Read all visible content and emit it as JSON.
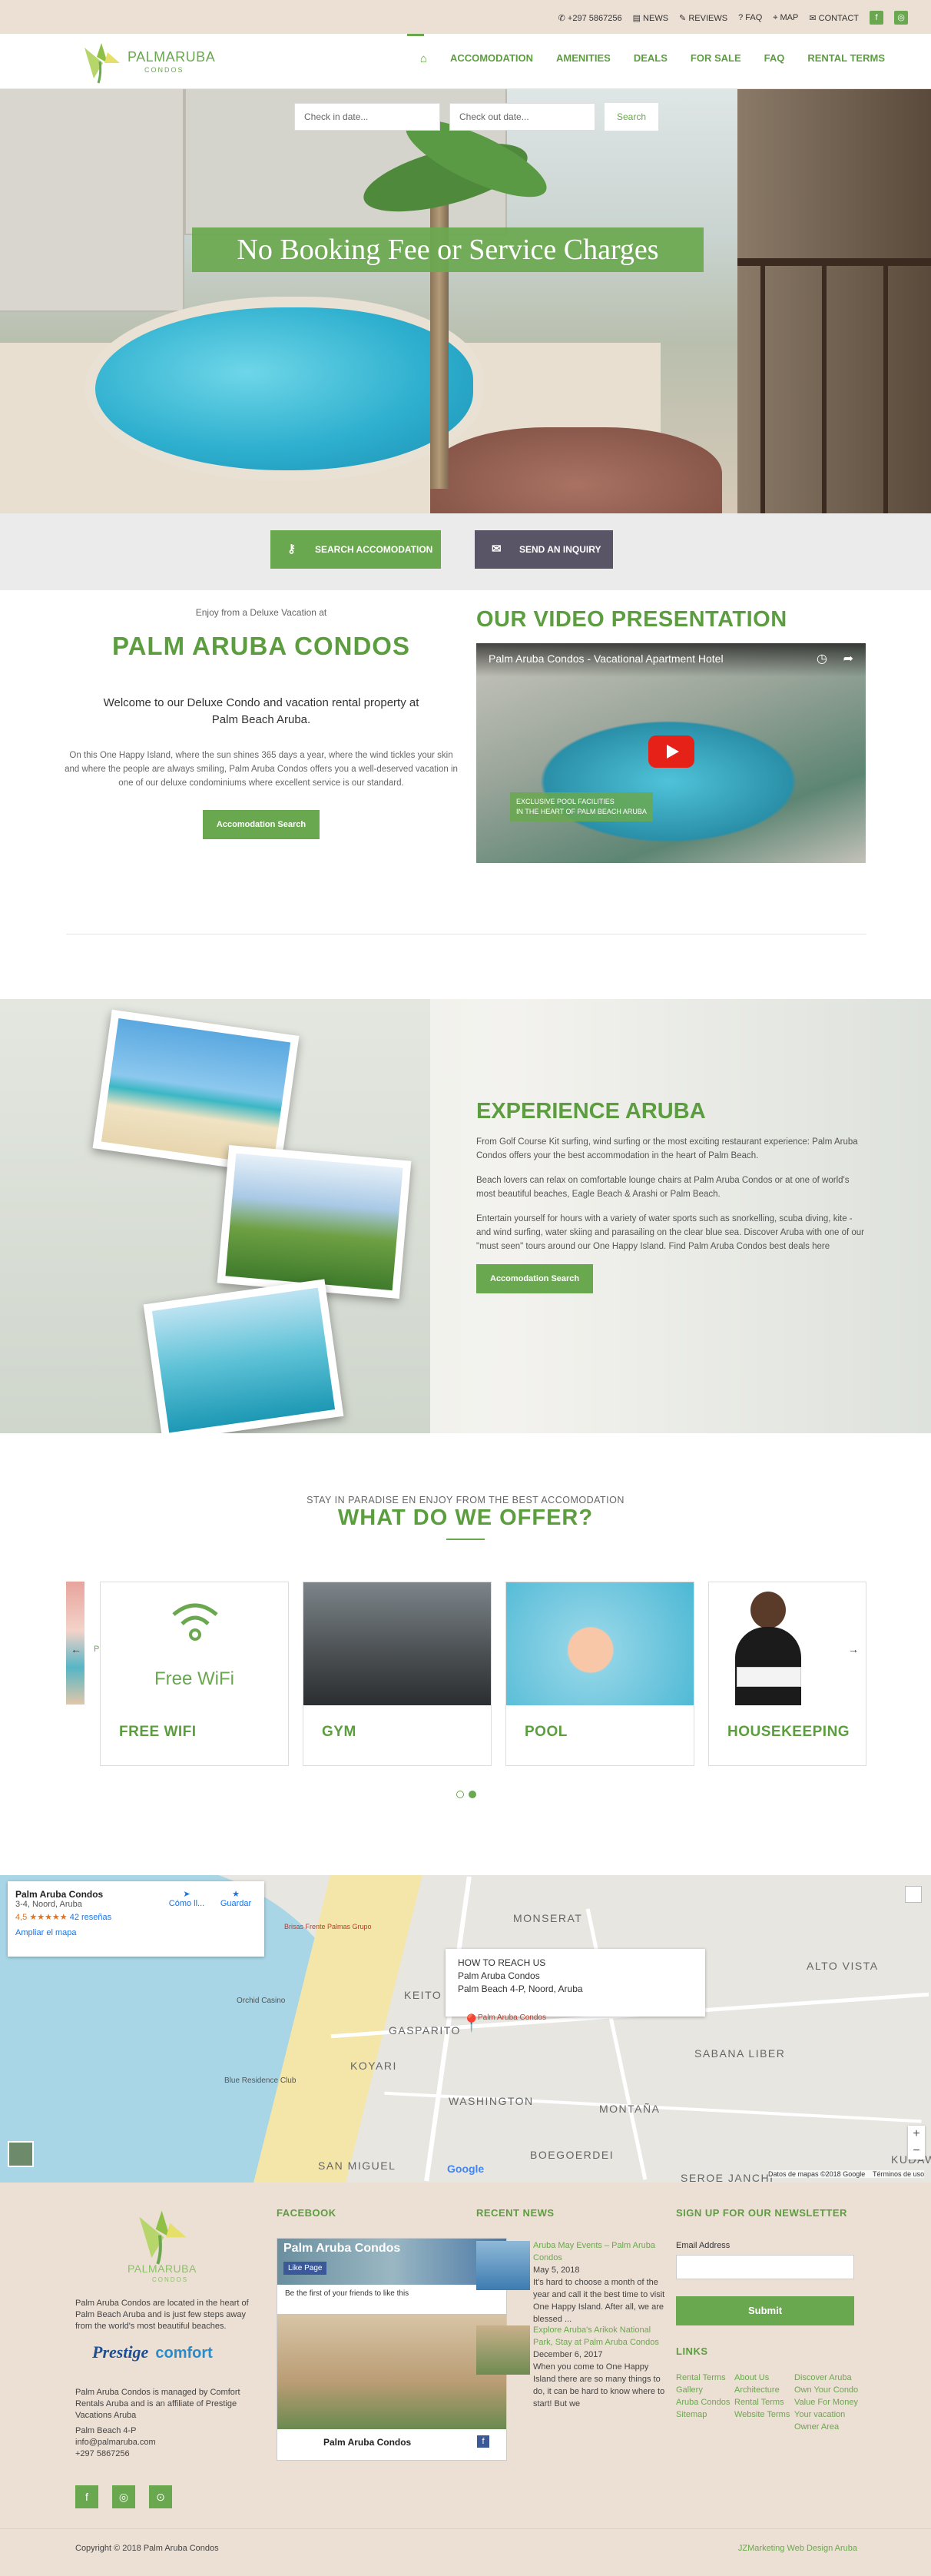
{
  "topbar": {
    "phone": "+297 5867256",
    "links": [
      "NEWS",
      "REVIEWS",
      "FAQ",
      "MAP",
      "CONTACT"
    ]
  },
  "brand": {
    "name": "PALMARUBA",
    "sub": "CONDOS"
  },
  "nav": [
    "ACCOMODATION",
    "AMENITIES",
    "DEALS",
    "FOR SALE",
    "FAQ",
    "RENTAL TERMS"
  ],
  "booking": {
    "checkin_placeholder": "Check in date...",
    "checkout_placeholder": "Check out date...",
    "search": "Search"
  },
  "hero": {
    "banner": "No Booking Fee or Service Charges"
  },
  "cta": {
    "search": "SEARCH ACCOMODATION",
    "inquiry": "SEND AN INQUIRY"
  },
  "welcome": {
    "kicker": "Enjoy from a Deluxe Vacation at",
    "title": "PALM ARUBA CONDOS",
    "lead": "Welcome to our Deluxe Condo and vacation rental property at Palm Beach Aruba.",
    "body": "On this One Happy Island, where the sun shines 365 days a year, where the wind tickles your skin and where the people are always smiling, Palm Aruba Condos offers you a well-deserved vacation in one of our deluxe condominiums where excellent service is our standard.",
    "button": "Accomodation Search"
  },
  "video": {
    "title": "OUR VIDEO PRESENTATION",
    "player_title": "Palm Aruba Condos - Vacational Apartment Hotel",
    "tag_line1": "EXCLUSIVE POOL FACILITIES",
    "tag_line2": "IN THE HEART OF PALM BEACH ARUBA"
  },
  "experience": {
    "title": "EXPERIENCE ARUBA",
    "p1": "From Golf Course Kit surfing, wind surfing or the most exciting restaurant experience: Palm Aruba Condos offers your the best accommodation in the heart of Palm Beach.",
    "p2": "Beach lovers can relax on comfortable lounge chairs at Palm Aruba Condos or at one of world's most beautiful beaches, Eagle Beach & Arashi or Palm Beach.",
    "p3": "Entertain yourself for hours with a variety of water sports such as snorkelling, scuba diving, kite - and wind surfing, water skiing and parasailing on the clear blue sea. Discover Aruba with one of our \"must seen\" tours around our One Happy Island. Find Palm Aruba Condos best deals here",
    "button": "Accomodation Search"
  },
  "offer": {
    "kicker": "STAY IN PARADISE EN ENJOY FROM THE BEST ACCOMODATION",
    "title": "WHAT DO WE OFFER?",
    "prev": "Prev",
    "wifi_text": "Free WiFi",
    "cards": [
      "FREE WIFI",
      "GYM",
      "POOL",
      "HOUSEKEEPING"
    ]
  },
  "map": {
    "place": "Palm Aruba Condos",
    "address": "3-4, Noord, Aruba",
    "rating": "4,5 ★★★★★",
    "reviews": "42 reseñas",
    "enlarge": "Ampliar el mapa",
    "directions": "Cómo ll...",
    "save": "Guardar",
    "info_title": "HOW TO REACH US",
    "info_name": "Palm Aruba Condos",
    "info_addr": "Palm Beach 4-P, Noord, Aruba",
    "pin_label": "Palm Aruba Condos",
    "labels": [
      "MONSERAT",
      "ALTO VISTA",
      "KEITO",
      "SABANA LIBER",
      "GASPARITO",
      "KOYARI",
      "WASHINGTON",
      "MONTAÑA",
      "SAN MIGUEL",
      "BOEGOERDEI",
      "SEROE JANCHI",
      "KUDAW"
    ],
    "pois": [
      "Orchid Casino",
      "Blue Residence Club",
      "Brisas Frente Palmas Grupo"
    ],
    "attribution": "Datos de mapas ©2018 Google    Términos de uso"
  },
  "footer": {
    "about1": "Palm Aruba Condos are located in the heart of Palm Beach Aruba and is just few steps away from the world's most beautiful beaches.",
    "about2": "Palm Aruba Condos is managed by Comfort Rentals Aruba and is an affiliate of Prestige Vacations Aruba",
    "address": "Palm Beach 4-P",
    "email": "info@palmaruba.com",
    "phone": "+297 5867256",
    "partner1": "Prestige",
    "partner2": "comfort",
    "facebook_title": "FACEBOOK",
    "fb_page": "Palm Aruba Condos",
    "fb_like": "Like Page",
    "fb_friends": "Be the first of your friends to like this",
    "news_title": "RECENT NEWS",
    "news": [
      {
        "title": "Aruba May Events – Palm Aruba Condos",
        "date": "May 5, 2018",
        "text": "It's hard to choose a month of the year and call it the best time to visit One Happy Island. After all, we are blessed ..."
      },
      {
        "title": "Explore Aruba's Arikok National Park, Stay at Palm Aruba Condos",
        "date": "December 6, 2017",
        "text": "When you come to One Happy Island there are so many things to do, it can be hard to know where to start! But we"
      }
    ],
    "newsletter_title": "SIGN UP FOR OUR NEWSLETTER",
    "email_label": "Email Address",
    "submit": "Submit",
    "links_title": "LINKS",
    "links_col1": [
      "Rental Terms",
      "Gallery",
      "Aruba Condos",
      "Sitemap"
    ],
    "links_col2": [
      "About Us",
      "Architecture",
      "Rental Terms",
      "Website Terms"
    ],
    "links_col3": [
      "Discover Aruba",
      "Own Your Condo",
      "Value For Money",
      "Your vacation",
      "Owner Area"
    ],
    "copyright": "Copyright © 2018 Palm Aruba Condos",
    "credit": "JZMarketing Web Design Aruba"
  },
  "colors": {
    "accent": "#6aa84f",
    "topbar": "#ecdfd3",
    "inquiry": "#5a5566"
  }
}
